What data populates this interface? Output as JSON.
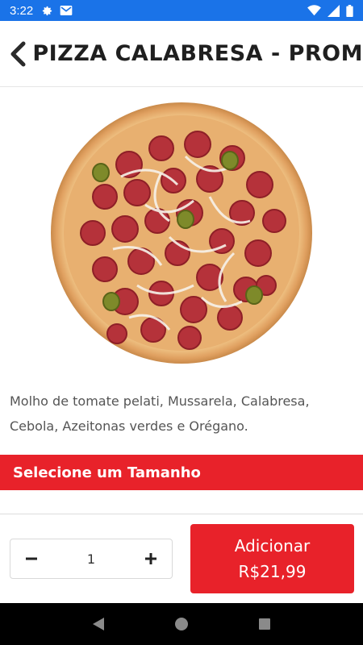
{
  "status_bar": {
    "time": "3:22",
    "left_icons": [
      "gear-icon",
      "gmail-icon"
    ],
    "right_icons": [
      "wifi-icon",
      "signal-icon",
      "battery-icon"
    ],
    "bg_color": "#1a73e8"
  },
  "header": {
    "back_icon": "chevron-left-icon",
    "title": "PIZZA CALABRESA - PROM"
  },
  "product": {
    "image_alt": "pizza-image",
    "description": "Molho de tomate pelati, Mussarela, Calabresa, Cebola, Azeitonas verdes e Orégano."
  },
  "size_section": {
    "label": "Selecione um Tamanho",
    "color": "#e8222a"
  },
  "quantity": {
    "value": "1",
    "decrement_icon": "minus-icon",
    "increment_icon": "plus-icon"
  },
  "add_button": {
    "label": "Adicionar",
    "price": "R$21,99",
    "color": "#e8222a"
  },
  "nav_bar": {
    "icons": [
      "back-triangle-icon",
      "home-circle-icon",
      "recents-square-icon"
    ]
  }
}
